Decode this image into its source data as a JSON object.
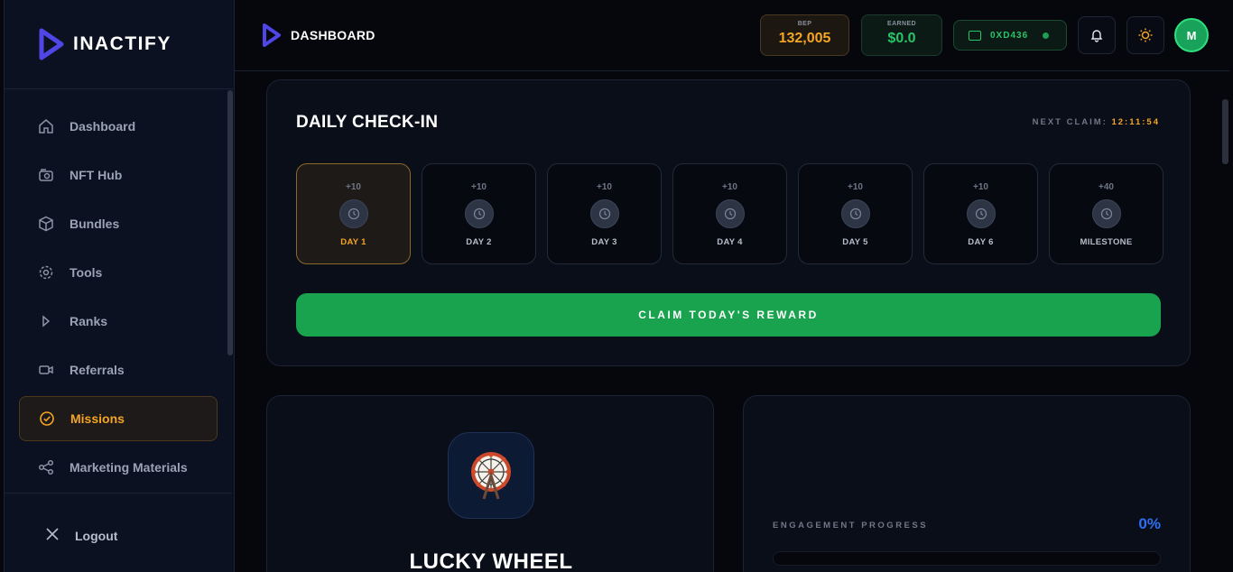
{
  "brand": {
    "name": "INACTIFY"
  },
  "sidebar": {
    "items": [
      {
        "label": "Dashboard",
        "icon": "home-icon"
      },
      {
        "label": "NFT Hub",
        "icon": "nft-icon"
      },
      {
        "label": "Bundles",
        "icon": "box-icon"
      },
      {
        "label": "Tools",
        "icon": "gear-icon"
      },
      {
        "label": "Ranks",
        "icon": "rank-icon"
      },
      {
        "label": "Referrals",
        "icon": "video-icon"
      },
      {
        "label": "Missions",
        "icon": "check-circle-icon",
        "active": true
      },
      {
        "label": "Marketing Materials",
        "icon": "share-icon"
      }
    ],
    "logout_label": "Logout"
  },
  "header": {
    "title": "DASHBOARD",
    "bep_label": "BEP",
    "bep_value": "132,005",
    "earned_label": "EARNED",
    "earned_value": "$0.0",
    "wallet": "0XD436",
    "avatar_initial": "M"
  },
  "checkin": {
    "title": "DAILY CHECK-IN",
    "next_label": "NEXT CLAIM:",
    "next_time": "12:11:54",
    "days": [
      {
        "points": "+10",
        "label": "DAY 1"
      },
      {
        "points": "+10",
        "label": "DAY 2"
      },
      {
        "points": "+10",
        "label": "DAY 3"
      },
      {
        "points": "+10",
        "label": "DAY 4"
      },
      {
        "points": "+10",
        "label": "DAY 5"
      },
      {
        "points": "+10",
        "label": "DAY 6"
      },
      {
        "points": "+40",
        "label": "MILESTONE"
      }
    ],
    "claim_label": "CLAIM TODAY'S REWARD"
  },
  "wheel": {
    "title": "LUCKY WHEEL"
  },
  "engagement": {
    "label": "ENGAGEMENT PROGRESS",
    "value": "0%",
    "progress": 0
  },
  "colors": {
    "accent": "#f5a524",
    "green": "#19a34e",
    "blue": "#2f6ff5",
    "bg": "#05070d"
  }
}
